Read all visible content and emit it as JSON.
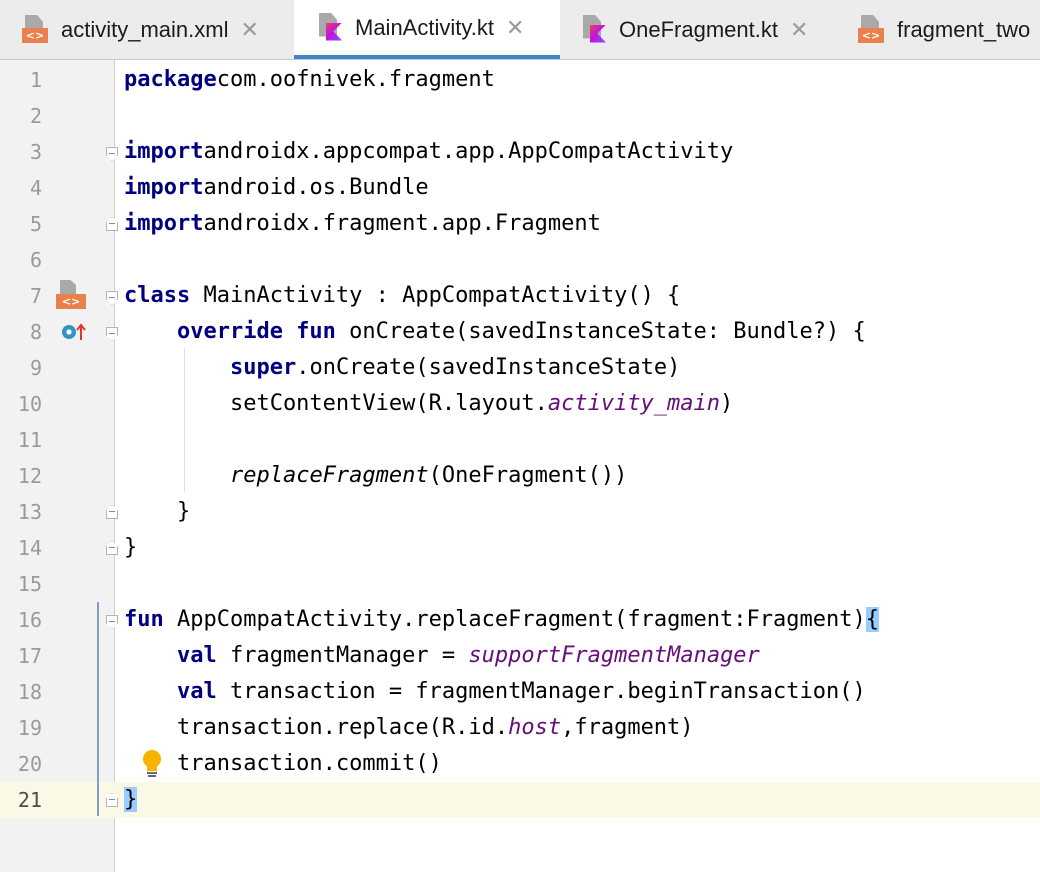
{
  "tabs": [
    {
      "label": "activity_main.xml",
      "icon": "xml-file-icon",
      "close": "✕",
      "active": false
    },
    {
      "label": "MainActivity.kt",
      "icon": "kotlin-file-icon",
      "close": "✕",
      "active": true
    },
    {
      "label": "OneFragment.kt",
      "icon": "kotlin-file-icon",
      "close": "✕",
      "active": false
    },
    {
      "label": "fragment_two",
      "icon": "xml-file-icon",
      "close": "",
      "active": false
    }
  ],
  "editor": {
    "current_line": 21,
    "lines": [
      {
        "n": "1",
        "tokens": [
          [
            "kw",
            "package"
          ],
          [
            "",
            "com.oofnivek.fragment"
          ]
        ]
      },
      {
        "n": "2",
        "tokens": []
      },
      {
        "n": "3",
        "tokens": [
          [
            "kw",
            "import"
          ],
          [
            "",
            "androidx.appcompat.app.AppCompatActivity"
          ]
        ]
      },
      {
        "n": "4",
        "tokens": [
          [
            "kw",
            "import"
          ],
          [
            "",
            "android.os.Bundle"
          ]
        ]
      },
      {
        "n": "5",
        "tokens": [
          [
            "kw",
            "import"
          ],
          [
            "",
            "androidx.fragment.app.Fragment"
          ]
        ]
      },
      {
        "n": "6",
        "tokens": []
      },
      {
        "n": "7",
        "tokens": [
          [
            "kw",
            "class"
          ],
          [
            "",
            " MainActivity : AppCompatActivity() {"
          ]
        ]
      },
      {
        "n": "8",
        "tokens": [
          [
            "",
            "    "
          ],
          [
            "kw",
            "override fun"
          ],
          [
            "",
            " onCreate(savedInstanceState: Bundle?) {"
          ]
        ]
      },
      {
        "n": "9",
        "tokens": [
          [
            "",
            "        "
          ],
          [
            "kw",
            "super"
          ],
          [
            "",
            ".onCreate(savedInstanceState)"
          ]
        ]
      },
      {
        "n": "10",
        "tokens": [
          [
            "",
            "        setContentView(R.layout."
          ],
          [
            "pu",
            "activity_main"
          ],
          [
            "",
            ")"
          ]
        ]
      },
      {
        "n": "11",
        "tokens": []
      },
      {
        "n": "12",
        "tokens": [
          [
            "",
            "        "
          ],
          [
            "it",
            "replaceFragment"
          ],
          [
            "",
            "(OneFragment())"
          ]
        ]
      },
      {
        "n": "13",
        "tokens": [
          [
            "",
            "    }"
          ]
        ]
      },
      {
        "n": "14",
        "tokens": [
          [
            "",
            "}"
          ]
        ]
      },
      {
        "n": "15",
        "tokens": []
      },
      {
        "n": "16",
        "tokens": [
          [
            "kw",
            "fun"
          ],
          [
            "",
            " AppCompatActivity.replaceFragment(fragment:Fragment)"
          ],
          [
            "brace",
            "{"
          ]
        ]
      },
      {
        "n": "17",
        "tokens": [
          [
            "",
            "    "
          ],
          [
            "kw",
            "val"
          ],
          [
            "",
            " fragmentManager = "
          ],
          [
            "pu",
            "supportFragmentManager"
          ]
        ]
      },
      {
        "n": "18",
        "tokens": [
          [
            "",
            "    "
          ],
          [
            "kw",
            "val"
          ],
          [
            "",
            " transaction = fragmentManager.beginTransaction()"
          ]
        ]
      },
      {
        "n": "19",
        "tokens": [
          [
            "",
            "    transaction.replace(R.id."
          ],
          [
            "pu",
            "host"
          ],
          [
            "",
            ",fragment)"
          ]
        ]
      },
      {
        "n": "20",
        "tokens": [
          [
            "",
            "    transaction.commit()"
          ]
        ]
      },
      {
        "n": "21",
        "tokens": [
          [
            "brace",
            "}"
          ]
        ]
      }
    ]
  },
  "gutter_icons": {
    "line7": "xml-layout-icon",
    "line8": "override-method-icon",
    "line20": "lightbulb-icon"
  },
  "colors": {
    "keyword": "#000080",
    "purple": "#660e7a",
    "brace_highlight": "#99ccff",
    "current_line": "#fcf8e6",
    "active_tab_underline": "#4083c9"
  }
}
